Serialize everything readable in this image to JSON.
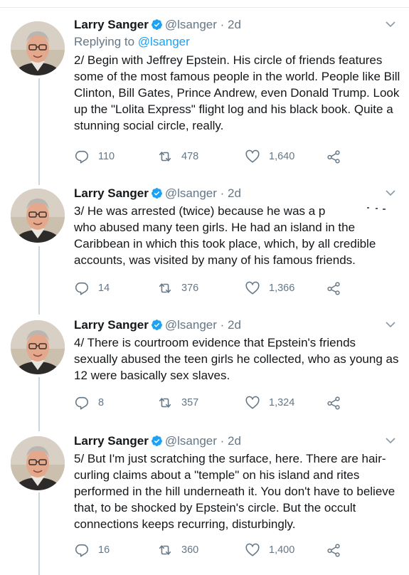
{
  "tweets": [
    {
      "name": "Larry Sanger",
      "handle": "@lsanger",
      "dot": "·",
      "time": "2d",
      "replying_prefix": "Replying to ",
      "replying_handle": "@lsanger",
      "text": "2/ Begin with Jeffrey Epstein. His circle of friends features some of the most famous people in the world. People like Bill Clinton, Bill Gates, Prince Andrew, even Donald Trump. Look up the \"Lolita Express\" flight log and his black book. Quite a stunning social circle, really.",
      "replies": "110",
      "retweets": "478",
      "likes": "1,640"
    },
    {
      "name": "Larry Sanger",
      "handle": "@lsanger",
      "dot": "·",
      "time": "2d",
      "text": "3/ He was arrested (twice) because he was a p\nwho abused many teen girls. He had an island in the Caribbean in which this took place, which, by all credible accounts, was visited by many of his famous friends.",
      "replies": "14",
      "retweets": "376",
      "likes": "1,366"
    },
    {
      "name": "Larry Sanger",
      "handle": "@lsanger",
      "dot": "·",
      "time": "2d",
      "text": "4/ There is courtroom evidence that Epstein's friends sexually abused the teen girls he collected, who as young as 12 were basically sex slaves.",
      "replies": "8",
      "retweets": "357",
      "likes": "1,324"
    },
    {
      "name": "Larry Sanger",
      "handle": "@lsanger",
      "dot": "·",
      "time": "2d",
      "text": "5/ But I'm just scratching the surface, here. There are hair-curling claims about a \"temple\" on his island and rites performed in the hill underneath it. You don't have to believe that, to be shocked by Epstein's circle. But the occult connections keeps recurring, disturbingly.",
      "replies": "16",
      "retweets": "360",
      "likes": "1,400"
    }
  ],
  "colors": {
    "text": "#14171a",
    "secondary": "#657786",
    "link": "#1da1f2",
    "verified": "#1da1f2",
    "thread_line": "#ccd6dd"
  },
  "icons": [
    "verified-badge-icon",
    "chevron-down-icon",
    "reply-icon",
    "retweet-icon",
    "like-heart-icon",
    "share-icon"
  ]
}
